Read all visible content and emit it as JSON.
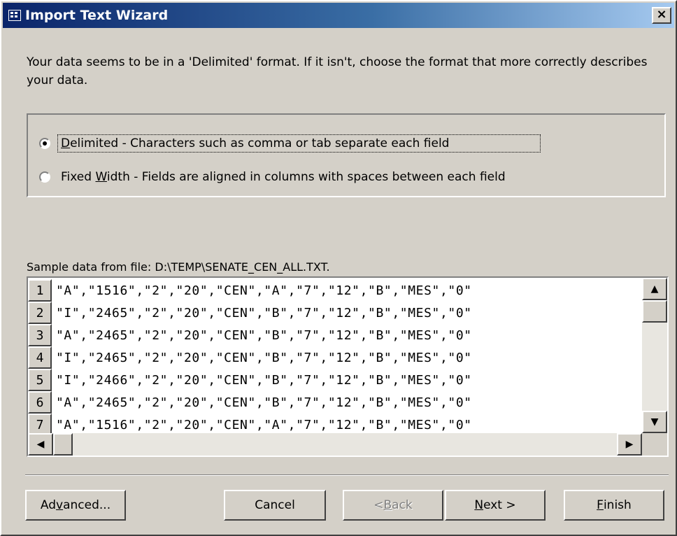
{
  "window": {
    "title": "Import Text Wizard",
    "close_label": "×"
  },
  "intro_text": "Your data seems to be in a 'Delimited' format. If it isn't, choose the format that more correctly describes your data.",
  "format_options": [
    {
      "label_prefix": "",
      "mnemonic": "D",
      "label_rest": "elimited - Characters such as comma or tab separate each field",
      "checked": true
    },
    {
      "label_prefix": "Fixed ",
      "mnemonic": "W",
      "label_rest": "idth - Fields are aligned in columns with spaces between each field",
      "checked": false
    }
  ],
  "sample": {
    "label": "Sample data from file: D:\\TEMP\\SENATE_CEN_ALL.TXT.",
    "rows": [
      {
        "num": "1",
        "text": "\"A\",\"1516\",\"2\",\"20\",\"CEN\",\"A\",\"7\",\"12\",\"B\",\"MES\",\"0\""
      },
      {
        "num": "2",
        "text": "\"I\",\"2465\",\"2\",\"20\",\"CEN\",\"B\",\"7\",\"12\",\"B\",\"MES\",\"0\""
      },
      {
        "num": "3",
        "text": "\"A\",\"2465\",\"2\",\"20\",\"CEN\",\"B\",\"7\",\"12\",\"B\",\"MES\",\"0\""
      },
      {
        "num": "4",
        "text": "\"I\",\"2465\",\"2\",\"20\",\"CEN\",\"B\",\"7\",\"12\",\"B\",\"MES\",\"0\""
      },
      {
        "num": "5",
        "text": "\"I\",\"2466\",\"2\",\"20\",\"CEN\",\"B\",\"7\",\"12\",\"B\",\"MES\",\"0\""
      },
      {
        "num": "6",
        "text": "\"A\",\"2465\",\"2\",\"20\",\"CEN\",\"B\",\"7\",\"12\",\"B\",\"MES\",\"0\""
      },
      {
        "num": "7",
        "text": "\"A\",\"1516\",\"2\",\"20\",\"CEN\",\"A\",\"7\",\"12\",\"B\",\"MES\",\"0\""
      }
    ]
  },
  "buttons": {
    "advanced": {
      "pre": "Ad",
      "mn": "v",
      "post": "anced..."
    },
    "cancel": {
      "label": "Cancel"
    },
    "back": {
      "pre": "< ",
      "mn": "B",
      "post": "ack"
    },
    "next": {
      "pre": "",
      "mn": "N",
      "post": "ext >"
    },
    "finish": {
      "pre": "",
      "mn": "F",
      "post": "inish"
    }
  },
  "icons": {
    "up": "▲",
    "down": "▼",
    "left": "◀",
    "right": "▶"
  }
}
